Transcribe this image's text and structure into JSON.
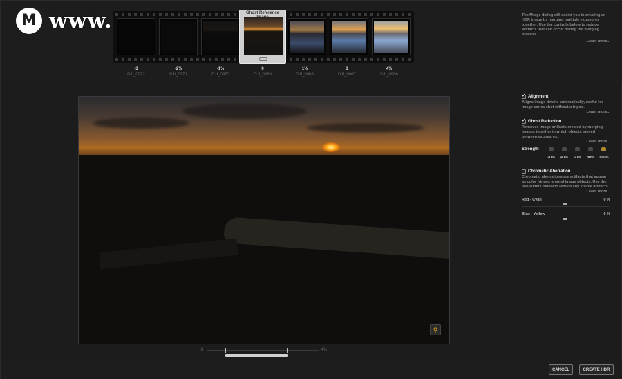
{
  "brand": {
    "logo_letter": "M",
    "name": "www.MacZ.com"
  },
  "filmstrip": {
    "ghost_reference_label": "Ghost Reference Image",
    "frames": [
      {
        "ev": "-3",
        "name": "DJI_0972",
        "brightness": 0.05
      },
      {
        "ev": "-2⅔",
        "name": "DJI_0971",
        "brightness": 0.08
      },
      {
        "ev": "-1⅓",
        "name": "DJI_0970",
        "brightness": 0.12
      },
      {
        "ev": "0",
        "name": "DJI_0969",
        "brightness": 0.3
      },
      {
        "ev": "1⅓",
        "name": "DJI_0968",
        "brightness": 0.5
      },
      {
        "ev": "3",
        "name": "DJI_0967",
        "brightness": 0.7
      },
      {
        "ev": "4⅔",
        "name": "DJI_0966",
        "brightness": 0.9
      }
    ]
  },
  "intro": {
    "text": "The Merge dialog will assist you in creating an HDR image by merging multiple exposures together. Use the controls below to reduce artifacts that can occur during the merging process.",
    "learn_more": "Learn more..."
  },
  "ev_range": {
    "min": "-3",
    "max": "4⅔"
  },
  "panel": {
    "alignment": {
      "title": "Alignment",
      "checked": true,
      "desc": "Aligns image details automatically, useful for image series shot without a tripod.",
      "learn_more": "Learn more..."
    },
    "ghost": {
      "title": "Ghost Reduction",
      "checked": true,
      "desc": "Removes image artifacts created by merging images together in which objects moved between exposures.",
      "learn_more": "Learn more...",
      "strength_label": "Strength",
      "options": [
        "20%",
        "40%",
        "60%",
        "80%",
        "100%"
      ],
      "selected": "100%"
    },
    "chromatic": {
      "title": "Chromatic Aberration",
      "checked": false,
      "desc": "Chromatic aberrations are artifacts that appear as color fringes around image objects. Use the two sliders below to reduce any visible artifacts.",
      "learn_more": "Learn more...",
      "red_cyan_label": "Red - Cyan",
      "red_cyan_value": "0 %",
      "blue_yellow_label": "Blue - Yellow",
      "blue_yellow_value": "0 %"
    }
  },
  "buttons": {
    "cancel": "CANCEL",
    "create": "CREATE HDR"
  }
}
